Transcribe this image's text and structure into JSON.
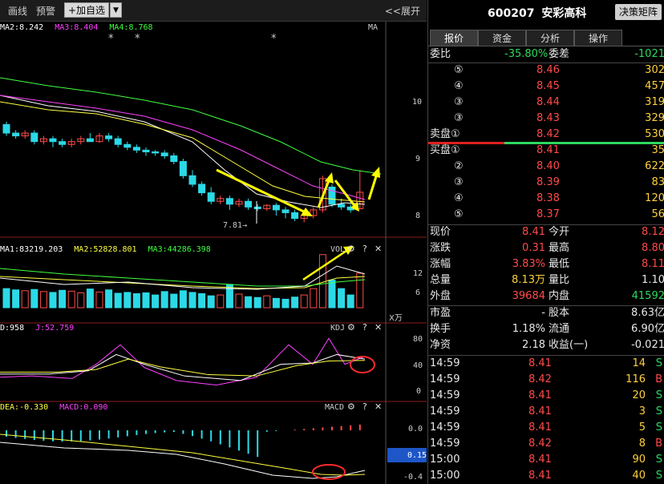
{
  "toolbar": {
    "draw_line": "画线",
    "alert": "预警",
    "add_watch": "+加自选",
    "dropdown": "▼",
    "expand": "<<展开"
  },
  "kline": {
    "ma_labels": [
      {
        "text": "MA2:8.242",
        "color": "#ffffff"
      },
      {
        "text": "MA3:8.404",
        "color": "#ff40ff"
      },
      {
        "text": "MA4:8.768",
        "color": "#40ff40"
      }
    ],
    "ma_tag": "MA",
    "axis": [
      "10",
      "9",
      "8"
    ],
    "low_label": "7.81→"
  },
  "volume": {
    "ma_labels": [
      {
        "text": "MA1:83219.203",
        "color": "#ffffff"
      },
      {
        "text": "MA2:52828.801",
        "color": "#ffff40"
      },
      {
        "text": "MA3:44286.398",
        "color": "#40ff40"
      }
    ],
    "tag": "VOL",
    "axis": [
      "12",
      "6"
    ],
    "unit": "X万"
  },
  "kdj": {
    "labels": [
      {
        "text": "D:958",
        "color": "#ffffff"
      },
      {
        "text": "J:52.759",
        "color": "#ff40ff"
      }
    ],
    "tag": "KDJ",
    "axis": [
      "80",
      "40",
      "0"
    ]
  },
  "macd": {
    "labels": [
      {
        "text": "DEA:-0.330",
        "color": "#ffff40"
      },
      {
        "text": "MACD:0.090",
        "color": "#ff40ff"
      }
    ],
    "tag": "MACD",
    "axis": [
      "0.0",
      "0.15",
      "-0.4"
    ]
  },
  "pane_controls": {
    "gear": "⚙",
    "help": "?",
    "close": "✕"
  },
  "quote": {
    "code": "600207",
    "name": "安彩高科",
    "matrix_button": "决策矩阵",
    "tabs": [
      "报价",
      "资金",
      "分析",
      "操作"
    ],
    "ratio_label": "委比",
    "ratio_value": "-35.80%",
    "diff_label": "委差",
    "diff_value": "-1021",
    "asks": [
      {
        "level": "⑤",
        "price": "8.46",
        "vol": "302"
      },
      {
        "level": "④",
        "price": "8.45",
        "vol": "457"
      },
      {
        "level": "③",
        "price": "8.44",
        "vol": "319"
      },
      {
        "level": "③",
        "price": "8.43",
        "vol": "329"
      },
      {
        "level": "卖盘①",
        "price": "8.42",
        "vol": "530"
      }
    ],
    "bids": [
      {
        "level": "买盘①",
        "price": "8.41",
        "vol": "35"
      },
      {
        "level": "②",
        "price": "8.40",
        "vol": "622"
      },
      {
        "level": "③",
        "price": "8.39",
        "vol": "83"
      },
      {
        "level": "④",
        "price": "8.38",
        "vol": "120"
      },
      {
        "level": "⑤",
        "price": "8.37",
        "vol": "56"
      }
    ],
    "stats": [
      {
        "l1": "现价",
        "v1": "8.41",
        "c1": "red",
        "l2": "今开",
        "v2": "8.12",
        "c2": "red"
      },
      {
        "l1": "涨跌",
        "v1": "0.31",
        "c1": "red",
        "l2": "最高",
        "v2": "8.80",
        "c2": "red"
      },
      {
        "l1": "涨幅",
        "v1": "3.83%",
        "c1": "red",
        "l2": "最低",
        "v2": "8.11",
        "c2": "red"
      },
      {
        "l1": "总量",
        "v1": "8.13万",
        "c1": "yellow",
        "l2": "量比",
        "v2": "1.10",
        "c2": "white"
      },
      {
        "l1": "外盘",
        "v1": "39684",
        "c1": "red",
        "l2": "内盘",
        "v2": "41592",
        "c2": "green"
      }
    ],
    "fundamentals": [
      {
        "l1": "市盈",
        "v1": "-",
        "l2": "股本",
        "v2": "8.63亿"
      },
      {
        "l1": "换手",
        "v1": "1.18%",
        "l2": "流通",
        "v2": "6.90亿"
      },
      {
        "l1": "净资",
        "v1": "2.18",
        "l2": "收益(一)",
        "v2": "-0.021"
      }
    ],
    "ticks": [
      {
        "time": "14:59",
        "price": "8.41",
        "vol": "14",
        "side": "S"
      },
      {
        "time": "14:59",
        "price": "8.42",
        "vol": "116",
        "side": "B"
      },
      {
        "time": "14:59",
        "price": "8.41",
        "vol": "20",
        "side": "S"
      },
      {
        "time": "14:59",
        "price": "8.41",
        "vol": "3",
        "side": "S"
      },
      {
        "time": "14:59",
        "price": "8.41",
        "vol": "5",
        "side": "S"
      },
      {
        "time": "14:59",
        "price": "8.42",
        "vol": "8",
        "side": "B"
      },
      {
        "time": "15:00",
        "price": "8.41",
        "vol": "90",
        "side": "S"
      },
      {
        "time": "15:00",
        "price": "8.41",
        "vol": "40",
        "side": "S"
      }
    ]
  },
  "colors": {
    "up": "#ff4a4a",
    "down": "#2cd9e6",
    "ma1": "#ffffff",
    "ma2": "#ffff40",
    "ma3": "#ff40ff",
    "ma4": "#40ff40",
    "annotation": "#ffff00",
    "circle": "#ff2a2a"
  }
}
